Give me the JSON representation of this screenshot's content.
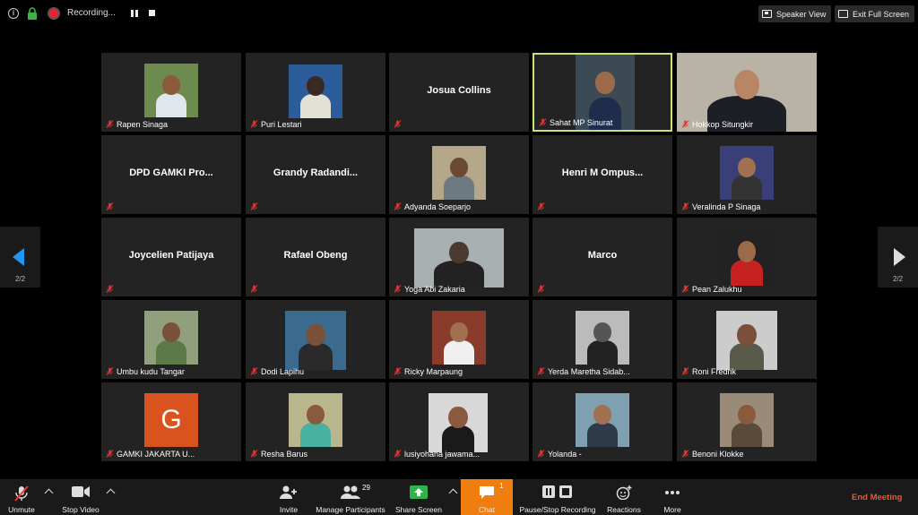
{
  "topbar": {
    "recording_label": "Recording...",
    "speaker_view_label": "Speaker View",
    "exit_fullscreen_label": "Exit Full Screen"
  },
  "pagination": {
    "left_page": "2/2",
    "right_page": "2/2"
  },
  "participants": [
    {
      "name": "Rapen Sinaga",
      "display": "",
      "video": true
    },
    {
      "name": "Puri Lestari",
      "display": "",
      "video": true
    },
    {
      "name": "",
      "display": "Josua Collins",
      "video": false
    },
    {
      "name": "Sahat MP Sinurat",
      "display": "",
      "video": true,
      "active": true
    },
    {
      "name": "Hokkop Situngkir",
      "display": "",
      "video": true
    },
    {
      "name": "",
      "display": "DPD GAMKI Pro...",
      "video": false
    },
    {
      "name": "",
      "display": "Grandy  Radandi...",
      "video": false
    },
    {
      "name": "Adyanda Soeparjo",
      "display": "",
      "video": true
    },
    {
      "name": "",
      "display": "Henri  M  Ompus...",
      "video": false
    },
    {
      "name": "Veralinda P Sinaga",
      "display": "",
      "video": true
    },
    {
      "name": "",
      "display": "Joycelien Patijaya",
      "video": false
    },
    {
      "name": "",
      "display": "Rafael Obeng",
      "video": false
    },
    {
      "name": "Yoga Abi Zakaria",
      "display": "",
      "video": true
    },
    {
      "name": "",
      "display": "Marco",
      "video": false
    },
    {
      "name": "Pean Zalukhu",
      "display": "",
      "video": true
    },
    {
      "name": "Umbu kudu Tangar",
      "display": "",
      "video": true
    },
    {
      "name": "Dodi Lapihu",
      "display": "",
      "video": true
    },
    {
      "name": "Ricky Marpaung",
      "display": "",
      "video": true
    },
    {
      "name": "Yerda Maretha Sidab...",
      "display": "",
      "video": true
    },
    {
      "name": "Roni Fredrik",
      "display": "",
      "video": true
    },
    {
      "name": "GAMKI JAKARTA U...",
      "display": "",
      "video": false,
      "letter": "G"
    },
    {
      "name": "Resha Barus",
      "display": "",
      "video": true
    },
    {
      "name": "lusiyohana jawama...",
      "display": "",
      "video": true
    },
    {
      "name": "Yolanda -",
      "display": "",
      "video": true
    },
    {
      "name": "Benoni Klokke",
      "display": "",
      "video": true
    }
  ],
  "toolbar": {
    "unmute": "Unmute",
    "stop_video": "Stop Video",
    "invite": "Invite",
    "manage_participants": "Manage Participants",
    "participant_count": "29",
    "share_screen": "Share Screen",
    "chat": "Chat",
    "chat_count": "1",
    "pause_stop_recording": "Pause/Stop Recording",
    "reactions": "Reactions",
    "more": "More",
    "end_meeting": "End Meeting"
  },
  "colors": {
    "active_speaker": "#c9e27b",
    "chat_accent": "#ef7d10",
    "end_meeting": "#e53333",
    "share_green": "#2fb34a"
  }
}
